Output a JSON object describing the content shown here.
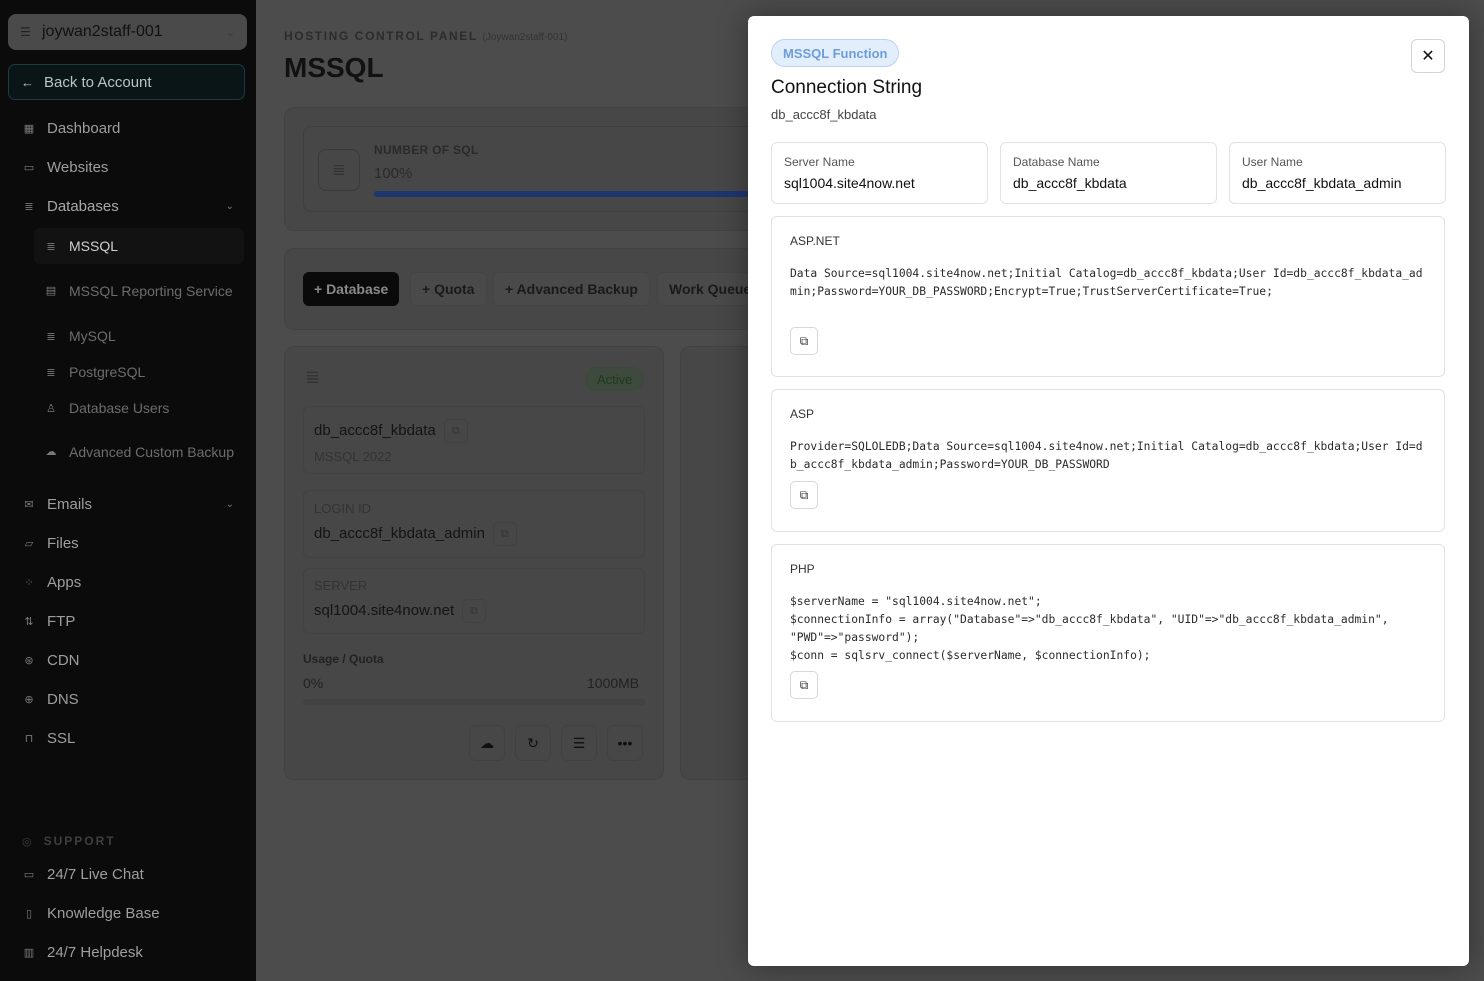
{
  "sidebar": {
    "account": "joywan2staff-001",
    "back_label": "Back to Account",
    "items": {
      "dashboard": "Dashboard",
      "websites": "Websites",
      "databases": "Databases",
      "mssql": "MSSQL",
      "mssql_reporting": "MSSQL Reporting Service",
      "mysql": "MySQL",
      "postgresql": "PostgreSQL",
      "database_users": "Database Users",
      "advanced_custom_backup": "Advanced Custom Backup",
      "emails": "Emails",
      "files": "Files",
      "apps": "Apps",
      "ftp": "FTP",
      "cdn": "CDN",
      "dns": "DNS",
      "ssl": "SSL"
    },
    "support": {
      "heading": "SUPPORT",
      "live_chat": "24/7 Live Chat",
      "knowledge_base": "Knowledge Base",
      "helpdesk": "24/7 Helpdesk"
    }
  },
  "main": {
    "eyebrow": "HOSTING CONTROL PANEL",
    "eyebrow_account": "(Joywan2staff-001)",
    "title": "MSSQL",
    "stat": {
      "label": "NUMBER OF SQL",
      "value": "100%",
      "fill_fraction": 1.0
    },
    "toolbar": {
      "add_database": "+ Database",
      "add_quota": "+ Quota",
      "advanced_backup": "+ Advanced Backup",
      "work_queue": "Work Queue"
    },
    "db_card": {
      "status": "Active",
      "name": "db_accc8f_kbdata",
      "version": "MSSQL 2022",
      "login_label": "LOGIN ID",
      "login_value": "db_accc8f_kbdata_admin",
      "server_label": "SERVER",
      "server_value": "sql1004.site4now.net",
      "usage_label": "Usage / Quota",
      "usage_value": "0%",
      "quota_value": "1000MB",
      "usage_fraction": 0.0
    }
  },
  "modal": {
    "badge": "MSSQL Function",
    "title": "Connection String",
    "subtitle": "db_accc8f_kbdata",
    "fields": {
      "server_label": "Server Name",
      "server_value": "sql1004.site4now.net",
      "database_label": "Database Name",
      "database_value": "db_accc8f_kbdata",
      "user_label": "User Name",
      "user_value": "db_accc8f_kbdata_admin"
    },
    "aspnet": {
      "label": "ASP.NET",
      "code": "Data Source=sql1004.site4now.net;Initial Catalog=db_accc8f_kbdata;User Id=db_accc8f_kbdata_admin;Password=YOUR_DB_PASSWORD;Encrypt=True;TrustServerCertificate=True;"
    },
    "asp": {
      "label": "ASP",
      "code": "Provider=SQLOLEDB;Data Source=sql1004.site4now.net;Initial Catalog=db_accc8f_kbdata;User Id=db_accc8f_kbdata_admin;Password=YOUR_DB_PASSWORD"
    },
    "php": {
      "label": "PHP",
      "code": "$serverName = \"sql1004.site4now.net\";\n$connectionInfo = array(\"Database\"=>\"db_accc8f_kbdata\", \"UID\"=>\"db_accc8f_kbdata_admin\",\n\"PWD\"=>\"password\");\n$conn = sqlsrv_connect($serverName, $connectionInfo);"
    }
  },
  "colors": {
    "accent_badge_bg": "#e3eefc",
    "accent_badge_text": "#6d9ddb",
    "progress_bar": "#1e3570",
    "active_badge": "#1c3a1c"
  }
}
